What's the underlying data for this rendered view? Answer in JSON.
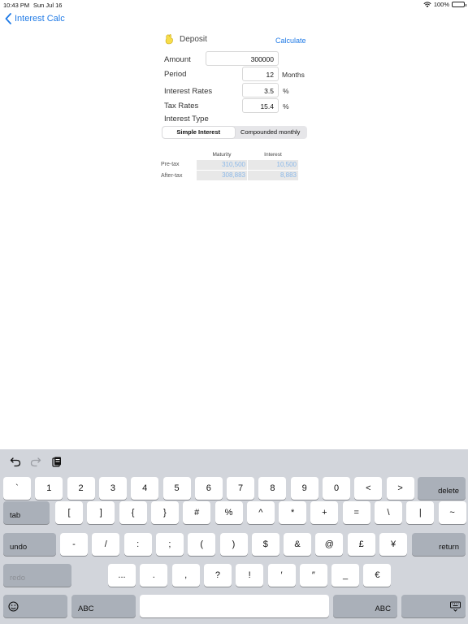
{
  "status_bar": {
    "time": "10:43 PM",
    "date": "Sun Jul 16",
    "battery": "100%",
    "battery_level": 1.0
  },
  "nav": {
    "back_label": "Interest Calc"
  },
  "form": {
    "title": "Deposit",
    "calculate_label": "Calculate",
    "amount_label": "Amount",
    "amount_value": "300000",
    "period_label": "Period",
    "period_value": "12",
    "period_unit": "Months",
    "rate_label": "Interest Rates",
    "rate_value": "3.5",
    "rate_unit": "%",
    "tax_label": "Tax Rates",
    "tax_value": "15.4",
    "tax_unit": "%",
    "type_label": "Interest Type",
    "type_options": [
      "Simple Interest",
      "Compounded monthly"
    ],
    "type_selected": "Simple Interest"
  },
  "results": {
    "headers": [
      "Maturity",
      "Interest"
    ],
    "rows": [
      {
        "label": "Pre-tax",
        "maturity": "310,500",
        "interest": "10,500"
      },
      {
        "label": "After-tax",
        "maturity": "308,883",
        "interest": "8,883"
      }
    ]
  },
  "keyboard": {
    "toolbar": [
      "undo-icon",
      "redo-icon",
      "paste-icon"
    ],
    "row1": [
      "`",
      "1",
      "2",
      "3",
      "4",
      "5",
      "6",
      "7",
      "8",
      "9",
      "0",
      "<",
      ">"
    ],
    "delete_label": "delete",
    "tab_label": "tab",
    "row2": [
      "[",
      "]",
      "{",
      "}",
      "#",
      "%",
      "^",
      "*",
      "+",
      "=",
      "\\",
      "|",
      "~"
    ],
    "undo_label": "undo",
    "row3": [
      "-",
      "/",
      ":",
      ";",
      "(",
      ")",
      "$",
      "&",
      "@",
      "£",
      "¥"
    ],
    "return_label": "return",
    "redo_label": "redo",
    "row4": [
      "...",
      ".",
      ",",
      "?",
      "!",
      "′",
      "″",
      "_",
      "€"
    ],
    "abc_label": "ABC",
    "emoji_icon": "emoji-icon",
    "dismiss_icon": "keyboard-dismiss-icon"
  },
  "colors": {
    "accent": "#1f7ae6",
    "result_text": "#8bb8e8",
    "keyboard_bg": "#d2d5db"
  }
}
